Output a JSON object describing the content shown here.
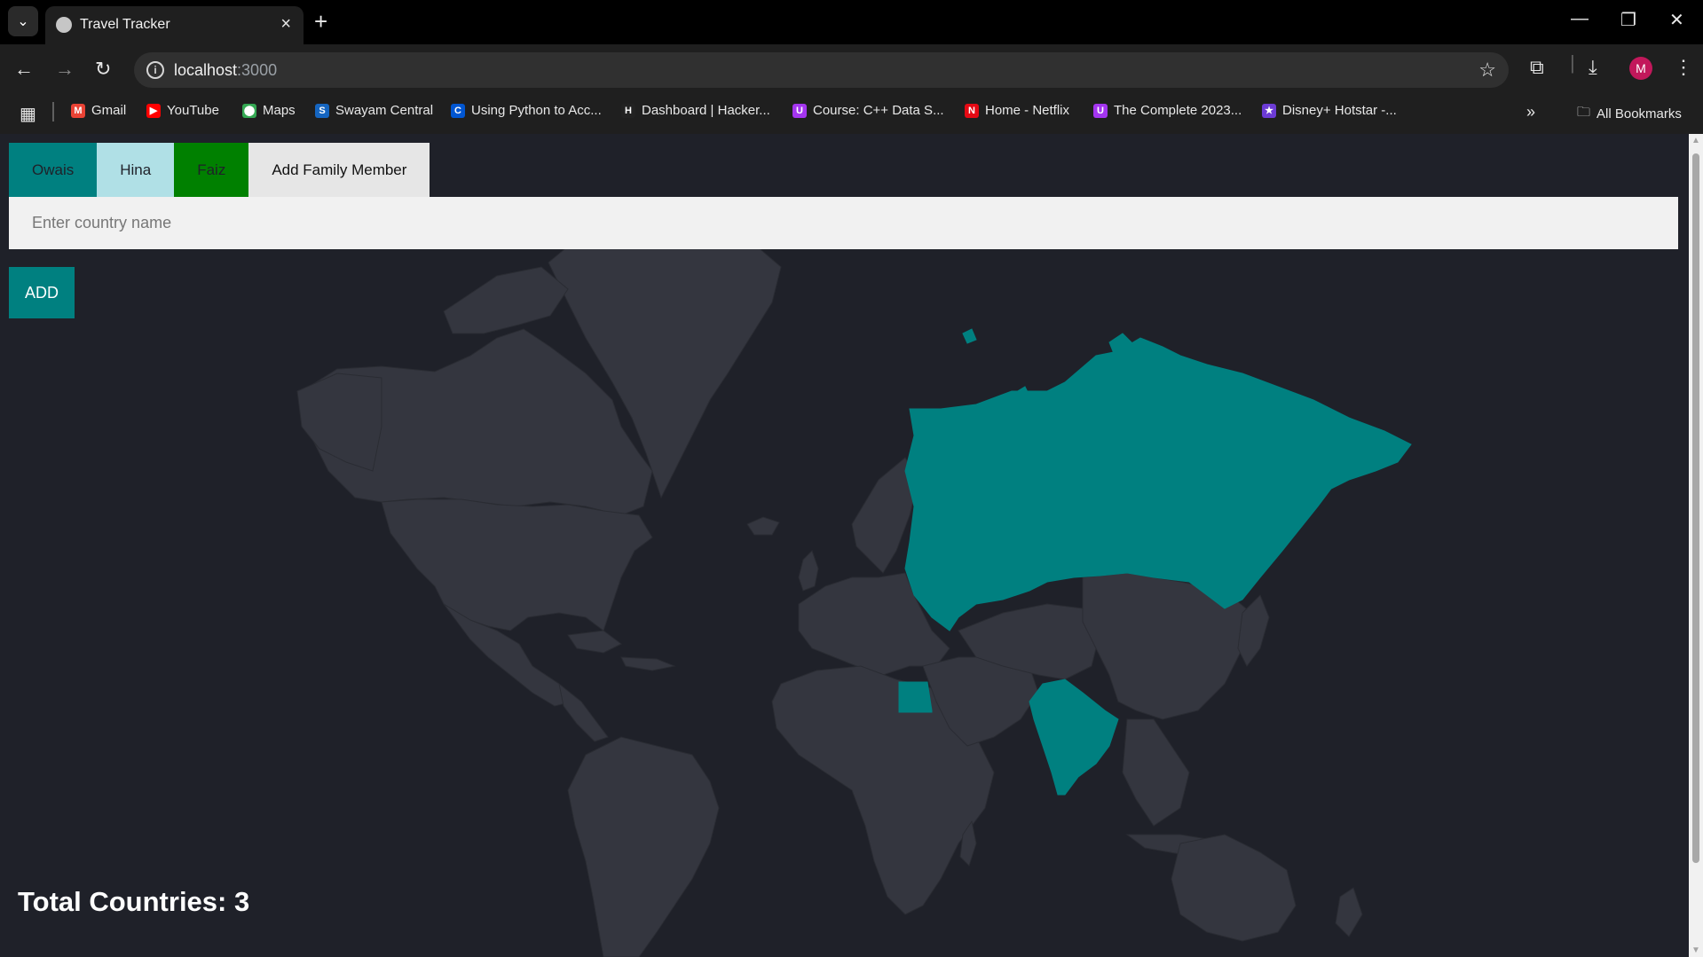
{
  "browser": {
    "tab_title": "Travel Tracker",
    "url_host": "localhost",
    "url_port": ":3000",
    "profile_initial": "M",
    "bookmarks": [
      {
        "label": "Gmail",
        "icon": "gmail-icon",
        "color": "#ea4335",
        "glyph": "M"
      },
      {
        "label": "YouTube",
        "icon": "youtube-icon",
        "color": "#ff0000",
        "glyph": "▶"
      },
      {
        "label": "Maps",
        "icon": "maps-icon",
        "color": "#34a853",
        "glyph": "⬤"
      },
      {
        "label": "Swayam Central",
        "icon": "swayam-icon",
        "color": "#1565c0",
        "glyph": "S"
      },
      {
        "label": "Using Python to Acc...",
        "icon": "coursera-icon",
        "color": "#0056d2",
        "glyph": "C"
      },
      {
        "label": "Dashboard | Hacker...",
        "icon": "hackerrank-icon",
        "color": "#222222",
        "glyph": "H"
      },
      {
        "label": "Course: C++ Data S...",
        "icon": "udemy-icon",
        "color": "#a435f0",
        "glyph": "U"
      },
      {
        "label": "Home - Netflix",
        "icon": "netflix-icon",
        "color": "#e50914",
        "glyph": "N"
      },
      {
        "label": "The Complete 2023...",
        "icon": "udemy-icon",
        "color": "#a435f0",
        "glyph": "U"
      },
      {
        "label": "Disney+ Hotstar -...",
        "icon": "hotstar-icon",
        "color": "#6c3bd5",
        "glyph": "★"
      }
    ],
    "all_bookmarks_label": "All Bookmarks"
  },
  "app": {
    "members": [
      {
        "name": "Owais",
        "bg": "#008080",
        "fg": "#1f2129"
      },
      {
        "name": "Hina",
        "bg": "#b0e0e6",
        "fg": "#1f2129"
      },
      {
        "name": "Faiz",
        "bg": "#008000",
        "fg": "#1f2129"
      }
    ],
    "add_member_label": "Add Family Member",
    "add_member_bg": "#e6e6e6",
    "country_placeholder": "Enter country name",
    "add_button_label": "ADD",
    "add_button_bg": "#008080",
    "total_label": "Total Countries: 3",
    "visited_countries": [
      "Russia",
      "India",
      "Egypt"
    ],
    "visited_color": "#008080",
    "land_color": "#34363f"
  }
}
